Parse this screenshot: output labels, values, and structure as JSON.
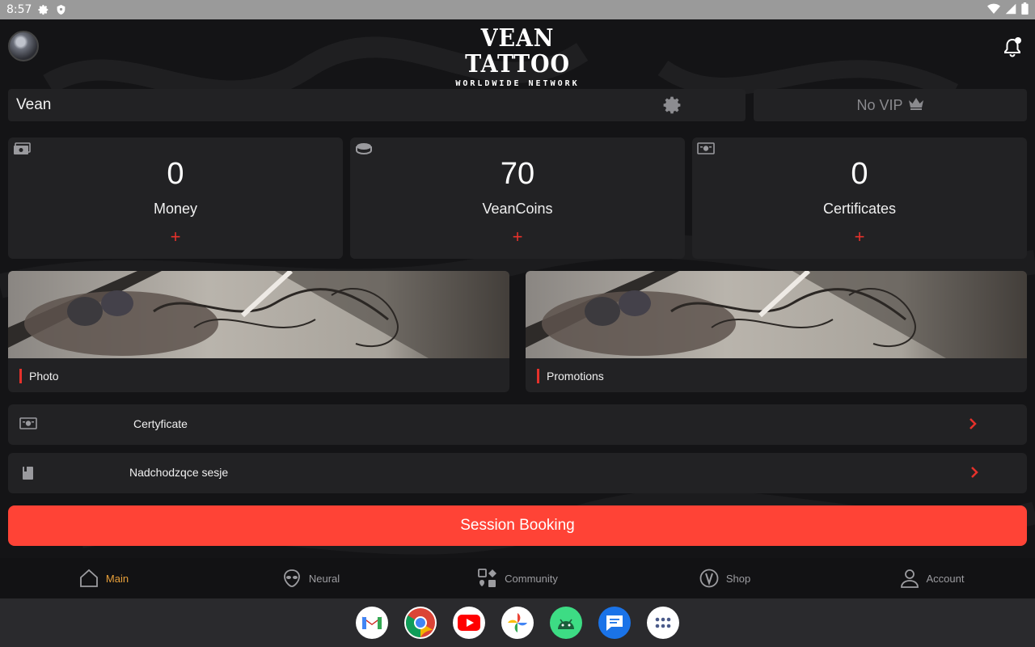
{
  "status_bar": {
    "time": "8:57"
  },
  "header": {
    "logo_title": "VEAN TATTOO",
    "logo_subtitle": "WORLDWIDE NETWORK"
  },
  "profile": {
    "name": "Vean",
    "vip_status": "No VIP"
  },
  "stats": [
    {
      "value": "0",
      "label": "Money",
      "add": "+"
    },
    {
      "value": "70",
      "label": "VeanCoins",
      "add": "+"
    },
    {
      "value": "0",
      "label": "Certificates",
      "add": "+"
    }
  ],
  "cards": [
    {
      "label": "Photo"
    },
    {
      "label": "Promotions"
    }
  ],
  "rows": [
    {
      "label": "Certyficate"
    },
    {
      "label": "Nadchodzqce sesje"
    }
  ],
  "booking_button": "Session Booking",
  "bottom_nav": [
    {
      "label": "Main",
      "icon": "home-icon"
    },
    {
      "label": "Neural",
      "icon": "alien-icon"
    },
    {
      "label": "Community",
      "icon": "community-icon"
    },
    {
      "label": "Shop",
      "icon": "shop-v-icon"
    },
    {
      "label": "Account",
      "icon": "person-icon"
    }
  ],
  "colors": {
    "accent": "#ff4336",
    "plus": "#e5312b",
    "nav_active": "#e8a03a",
    "card_bg": "#222224"
  }
}
